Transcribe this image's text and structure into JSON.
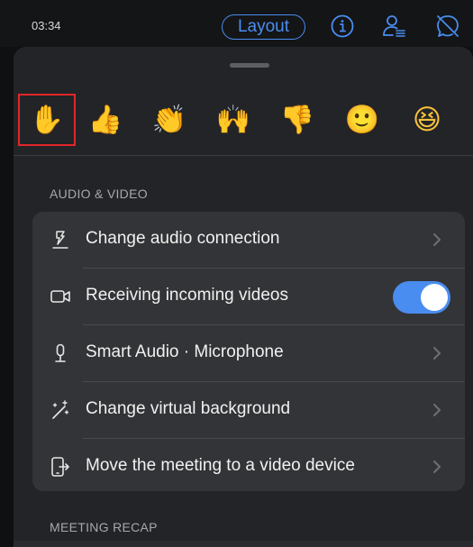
{
  "status_bar": {
    "time": "03:34"
  },
  "header": {
    "layout_label": "Layout",
    "icons": [
      "info-icon",
      "participants-icon",
      "chat-off-icon"
    ]
  },
  "reactions": {
    "items": [
      "✋",
      "👍",
      "👏",
      "🙌",
      "👎",
      "🙂",
      "😆"
    ],
    "names": [
      "raise-hand",
      "thumbs-up",
      "clap",
      "celebrate",
      "thumbs-down",
      "smile",
      "laugh"
    ],
    "selected_index": 0
  },
  "sections": {
    "audio_video": {
      "title": "AUDIO & VIDEO",
      "rows": [
        {
          "label": "Change audio connection",
          "icon": "audio-connection-icon",
          "control": "chevron"
        },
        {
          "label": "Receiving incoming videos",
          "icon": "video-camera-icon",
          "control": "toggle",
          "toggle_on": true
        },
        {
          "label": "Smart Audio · Microphone",
          "icon": "microphone-icon",
          "control": "chevron"
        },
        {
          "label": "Change virtual background",
          "icon": "magic-wand-icon",
          "control": "chevron"
        },
        {
          "label": "Move the meeting to a video device",
          "icon": "move-to-device-icon",
          "control": "chevron"
        }
      ]
    },
    "meeting_recap": {
      "title": "MEETING RECAP"
    }
  },
  "colors": {
    "accent": "#4a8df0",
    "selection": "#e2262a",
    "sheet": "#232427",
    "card": "#333437"
  }
}
